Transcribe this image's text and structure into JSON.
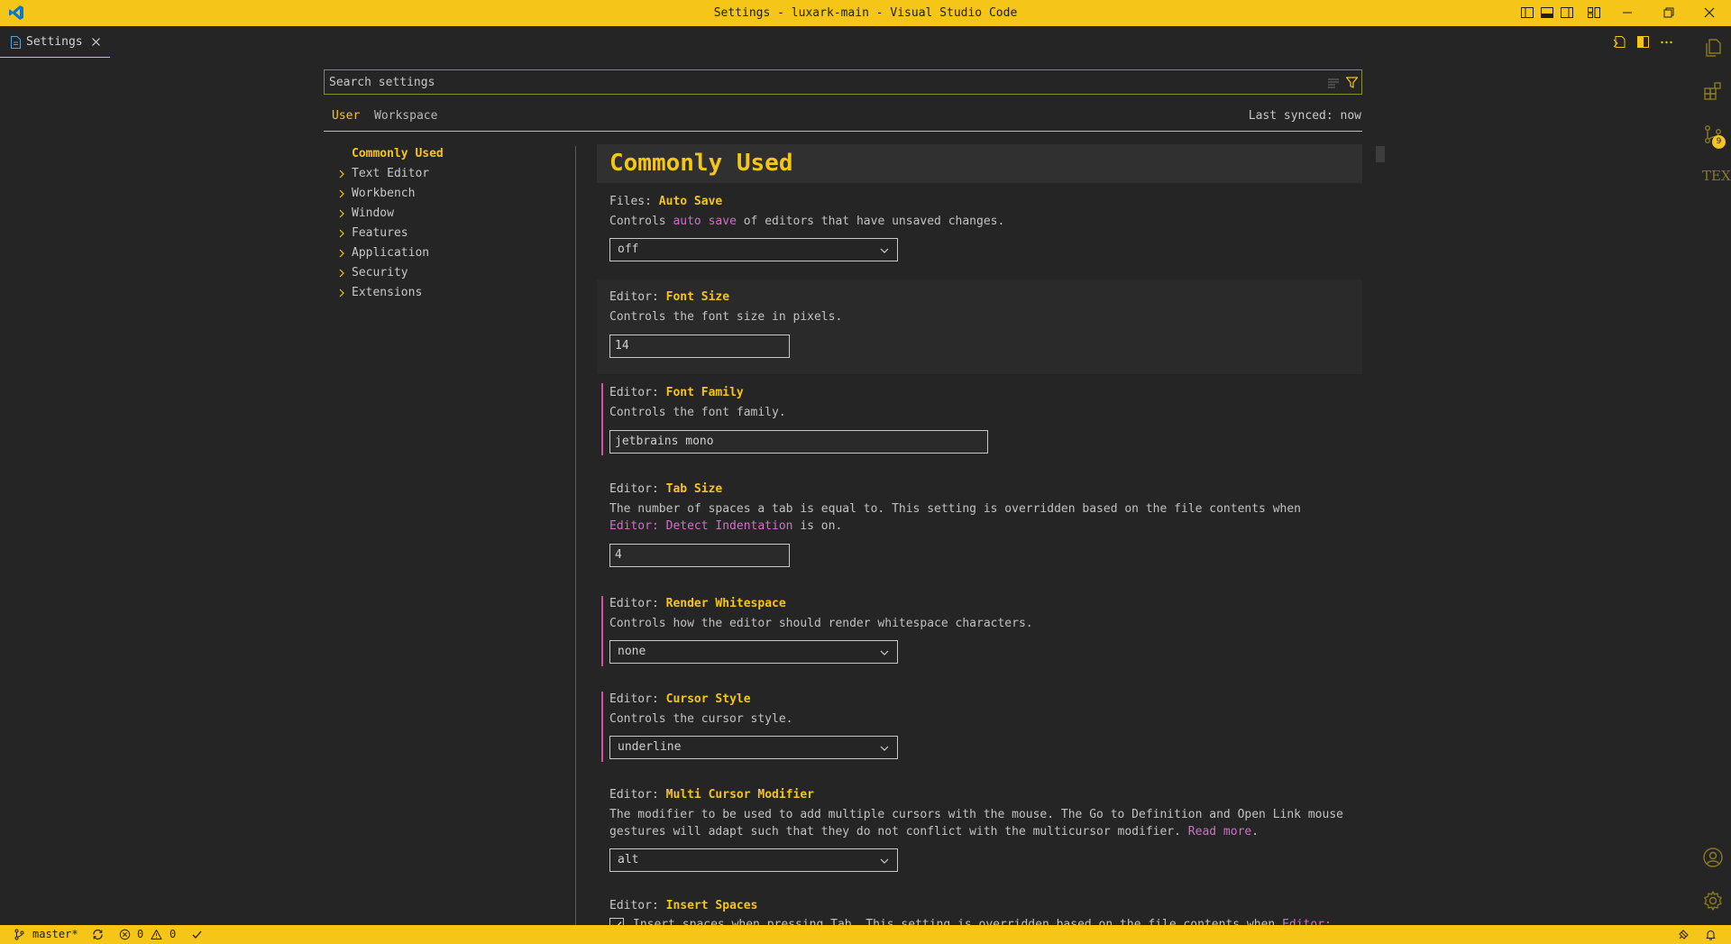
{
  "window": {
    "title": "Settings - luxark-main - Visual Studio Code",
    "accent": "#f5c518",
    "background": "#252525"
  },
  "titlebar_icons": [
    "vscode-logo-icon",
    "toggle-primary-sidebar-icon",
    "toggle-panel-icon",
    "toggle-secondary-sidebar-icon",
    "customize-layout-icon",
    "minimize-icon",
    "restore-icon",
    "close-window-icon"
  ],
  "tab": {
    "label": "Settings",
    "icon": "settings-file-icon"
  },
  "editor_actions": [
    "open-settings-json-icon",
    "split-editor-icon",
    "more-actions-icon"
  ],
  "activity_bar": {
    "items": [
      "explorer-icon",
      "extensions-icon",
      "source-control-icon",
      "tex-icon"
    ],
    "source_control_badge": "9",
    "tex_label": "TEX",
    "bottom": [
      "accounts-icon",
      "manage-gear-icon"
    ]
  },
  "search": {
    "placeholder": "Search settings",
    "value": ""
  },
  "scope": {
    "user": "User",
    "workspace": "Workspace",
    "active": "User",
    "synced": "Last synced: now"
  },
  "toc": [
    {
      "label": "Commonly Used",
      "active": true,
      "expandable": false
    },
    {
      "label": "Text Editor",
      "active": false,
      "expandable": true
    },
    {
      "label": "Workbench",
      "active": false,
      "expandable": true
    },
    {
      "label": "Window",
      "active": false,
      "expandable": true
    },
    {
      "label": "Features",
      "active": false,
      "expandable": true
    },
    {
      "label": "Application",
      "active": false,
      "expandable": true
    },
    {
      "label": "Security",
      "active": false,
      "expandable": true
    },
    {
      "label": "Extensions",
      "active": false,
      "expandable": true
    }
  ],
  "section": {
    "title": "Commonly Used"
  },
  "settings": {
    "auto_save": {
      "category": "Files: ",
      "name": "Auto Save",
      "desc_pre": "Controls ",
      "desc_link": "auto save",
      "desc_post": " of editors that have unsaved changes.",
      "value": "off"
    },
    "font_size": {
      "category": "Editor: ",
      "name": "Font Size",
      "desc": "Controls the font size in pixels.",
      "value": "14"
    },
    "font_family": {
      "category": "Editor: ",
      "name": "Font Family",
      "desc": "Controls the font family.",
      "value": "jetbrains mono"
    },
    "tab_size": {
      "category": "Editor: ",
      "name": "Tab Size",
      "desc_line1": "The number of spaces a tab is equal to. This setting is overridden based on the file contents when",
      "desc_link": "Editor: Detect Indentation",
      "desc_post": " is on.",
      "value": "4"
    },
    "render_whitespace": {
      "category": "Editor: ",
      "name": "Render Whitespace",
      "desc": "Controls how the editor should render whitespace characters.",
      "value": "none"
    },
    "cursor_style": {
      "category": "Editor: ",
      "name": "Cursor Style",
      "desc": "Controls the cursor style.",
      "value": "underline"
    },
    "multi_cursor_modifier": {
      "category": "Editor: ",
      "name": "Multi Cursor Modifier",
      "desc_line1": "The modifier to be used to add multiple cursors with the mouse. The Go to Definition and Open Link mouse",
      "desc_line2_pre": "gestures will adapt such that they do not conflict with the multicursor modifier. ",
      "desc_link": "Read more",
      "desc_post": ".",
      "value": "alt"
    },
    "insert_spaces": {
      "category": "Editor: ",
      "name": "Insert Spaces",
      "desc_pre": "Insert spaces when pressing Tab. This setting is overridden based on the file contents when ",
      "desc_link": "Editor:",
      "checked": true
    }
  },
  "statusbar": {
    "branch": "master*",
    "errors": "0",
    "warnings": "0"
  }
}
